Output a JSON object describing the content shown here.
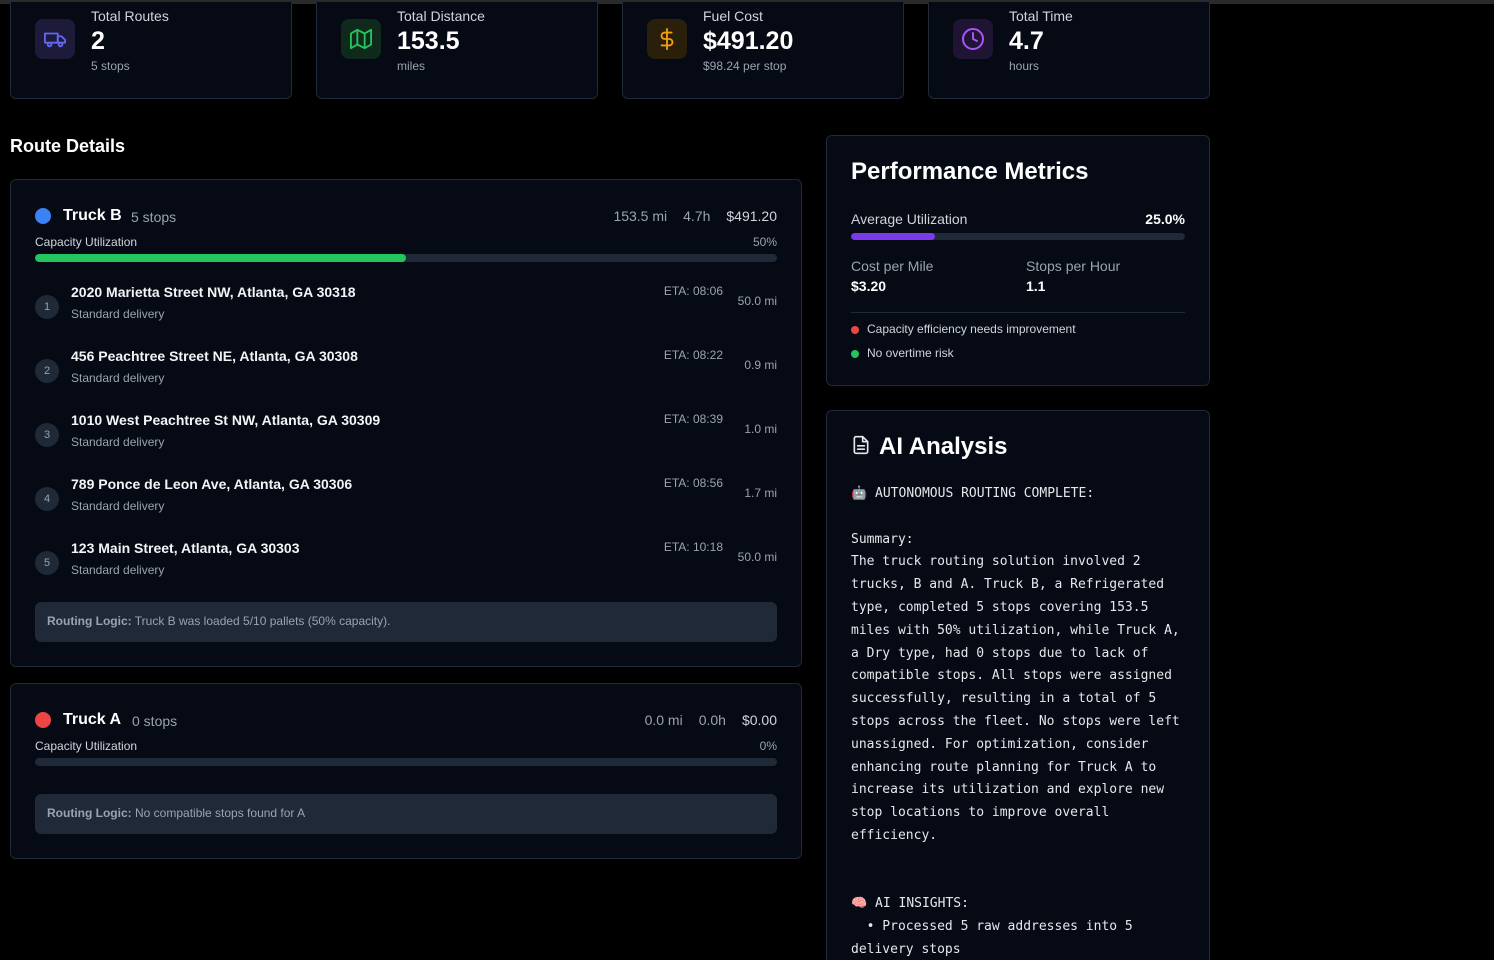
{
  "stats": [
    {
      "label": "Total Routes",
      "value": "2",
      "sub": "5 stops",
      "icon": "truck-icon",
      "color": "#6366f1"
    },
    {
      "label": "Total Distance",
      "value": "153.5",
      "sub": "miles",
      "icon": "map-icon",
      "color": "#22c55e"
    },
    {
      "label": "Fuel Cost",
      "value": "$491.20",
      "sub": "$98.24 per stop",
      "icon": "dollar-icon",
      "color": "#f59e0b"
    },
    {
      "label": "Total Time",
      "value": "4.7",
      "sub": "hours",
      "icon": "clock-icon",
      "color": "#a855f7"
    }
  ],
  "section_title": "Route Details",
  "trucks": [
    {
      "name": "Truck B",
      "stops_label": "5 stops",
      "color": "#3b82f6",
      "distance": "153.5 mi",
      "time": "4.7h",
      "cost": "$491.20",
      "capacity_label": "Capacity Utilization",
      "capacity_pct": "50%",
      "capacity_fraction": 0.5,
      "stops": [
        {
          "num": "1",
          "address": "2020 Marietta Street NW, Atlanta, GA 30318",
          "type": "Standard delivery",
          "eta": "ETA: 08:06",
          "dist": "50.0 mi"
        },
        {
          "num": "2",
          "address": "456 Peachtree Street NE, Atlanta, GA 30308",
          "type": "Standard delivery",
          "eta": "ETA: 08:22",
          "dist": "0.9 mi"
        },
        {
          "num": "3",
          "address": "1010 West Peachtree St NW, Atlanta, GA 30309",
          "type": "Standard delivery",
          "eta": "ETA: 08:39",
          "dist": "1.0 mi"
        },
        {
          "num": "4",
          "address": "789 Ponce de Leon Ave, Atlanta, GA 30306",
          "type": "Standard delivery",
          "eta": "ETA: 08:56",
          "dist": "1.7 mi"
        },
        {
          "num": "5",
          "address": "123 Main Street, Atlanta, GA 30303",
          "type": "Standard delivery",
          "eta": "ETA: 10:18",
          "dist": "50.0 mi"
        }
      ],
      "logic_label": "Routing Logic:",
      "logic_text": "Truck B was loaded 5/10 pallets (50% capacity)."
    },
    {
      "name": "Truck A",
      "stops_label": "0 stops",
      "color": "#ef4444",
      "distance": "0.0 mi",
      "time": "0.0h",
      "cost": "$0.00",
      "capacity_label": "Capacity Utilization",
      "capacity_pct": "0%",
      "capacity_fraction": 0,
      "logic_label": "Routing Logic:",
      "logic_text": "No compatible stops found for A"
    }
  ],
  "performance": {
    "title": "Performance Metrics",
    "avg_label": "Average Utilization",
    "avg_value": "25.0%",
    "avg_fraction": 0.25,
    "cost_label": "Cost per Mile",
    "cost_value": "$3.20",
    "sph_label": "Stops per Hour",
    "sph_value": "1.1",
    "notes": [
      {
        "text": "Capacity efficiency needs improvement",
        "color": "#ef4444"
      },
      {
        "text": "No overtime risk",
        "color": "#22c55e"
      }
    ]
  },
  "ai": {
    "title": "AI Analysis",
    "body": "🤖 AUTONOMOUS ROUTING COMPLETE:\n\nSummary:\nThe truck routing solution involved 2 trucks, B and A. Truck B, a Refrigerated type, completed 5 stops covering 153.5 miles with 50% utilization, while Truck A, a Dry type, had 0 stops due to lack of compatible stops. All stops were assigned successfully, resulting in a total of 5 stops across the fleet. No stops were left unassigned. For optimization, consider enhancing route planning for Truck A to increase its utilization and explore new stop locations to improve overall efficiency.\n\n\n🧠 AI INSIGHTS:\n  • Processed 5 raw addresses into 5 delivery stops"
  }
}
